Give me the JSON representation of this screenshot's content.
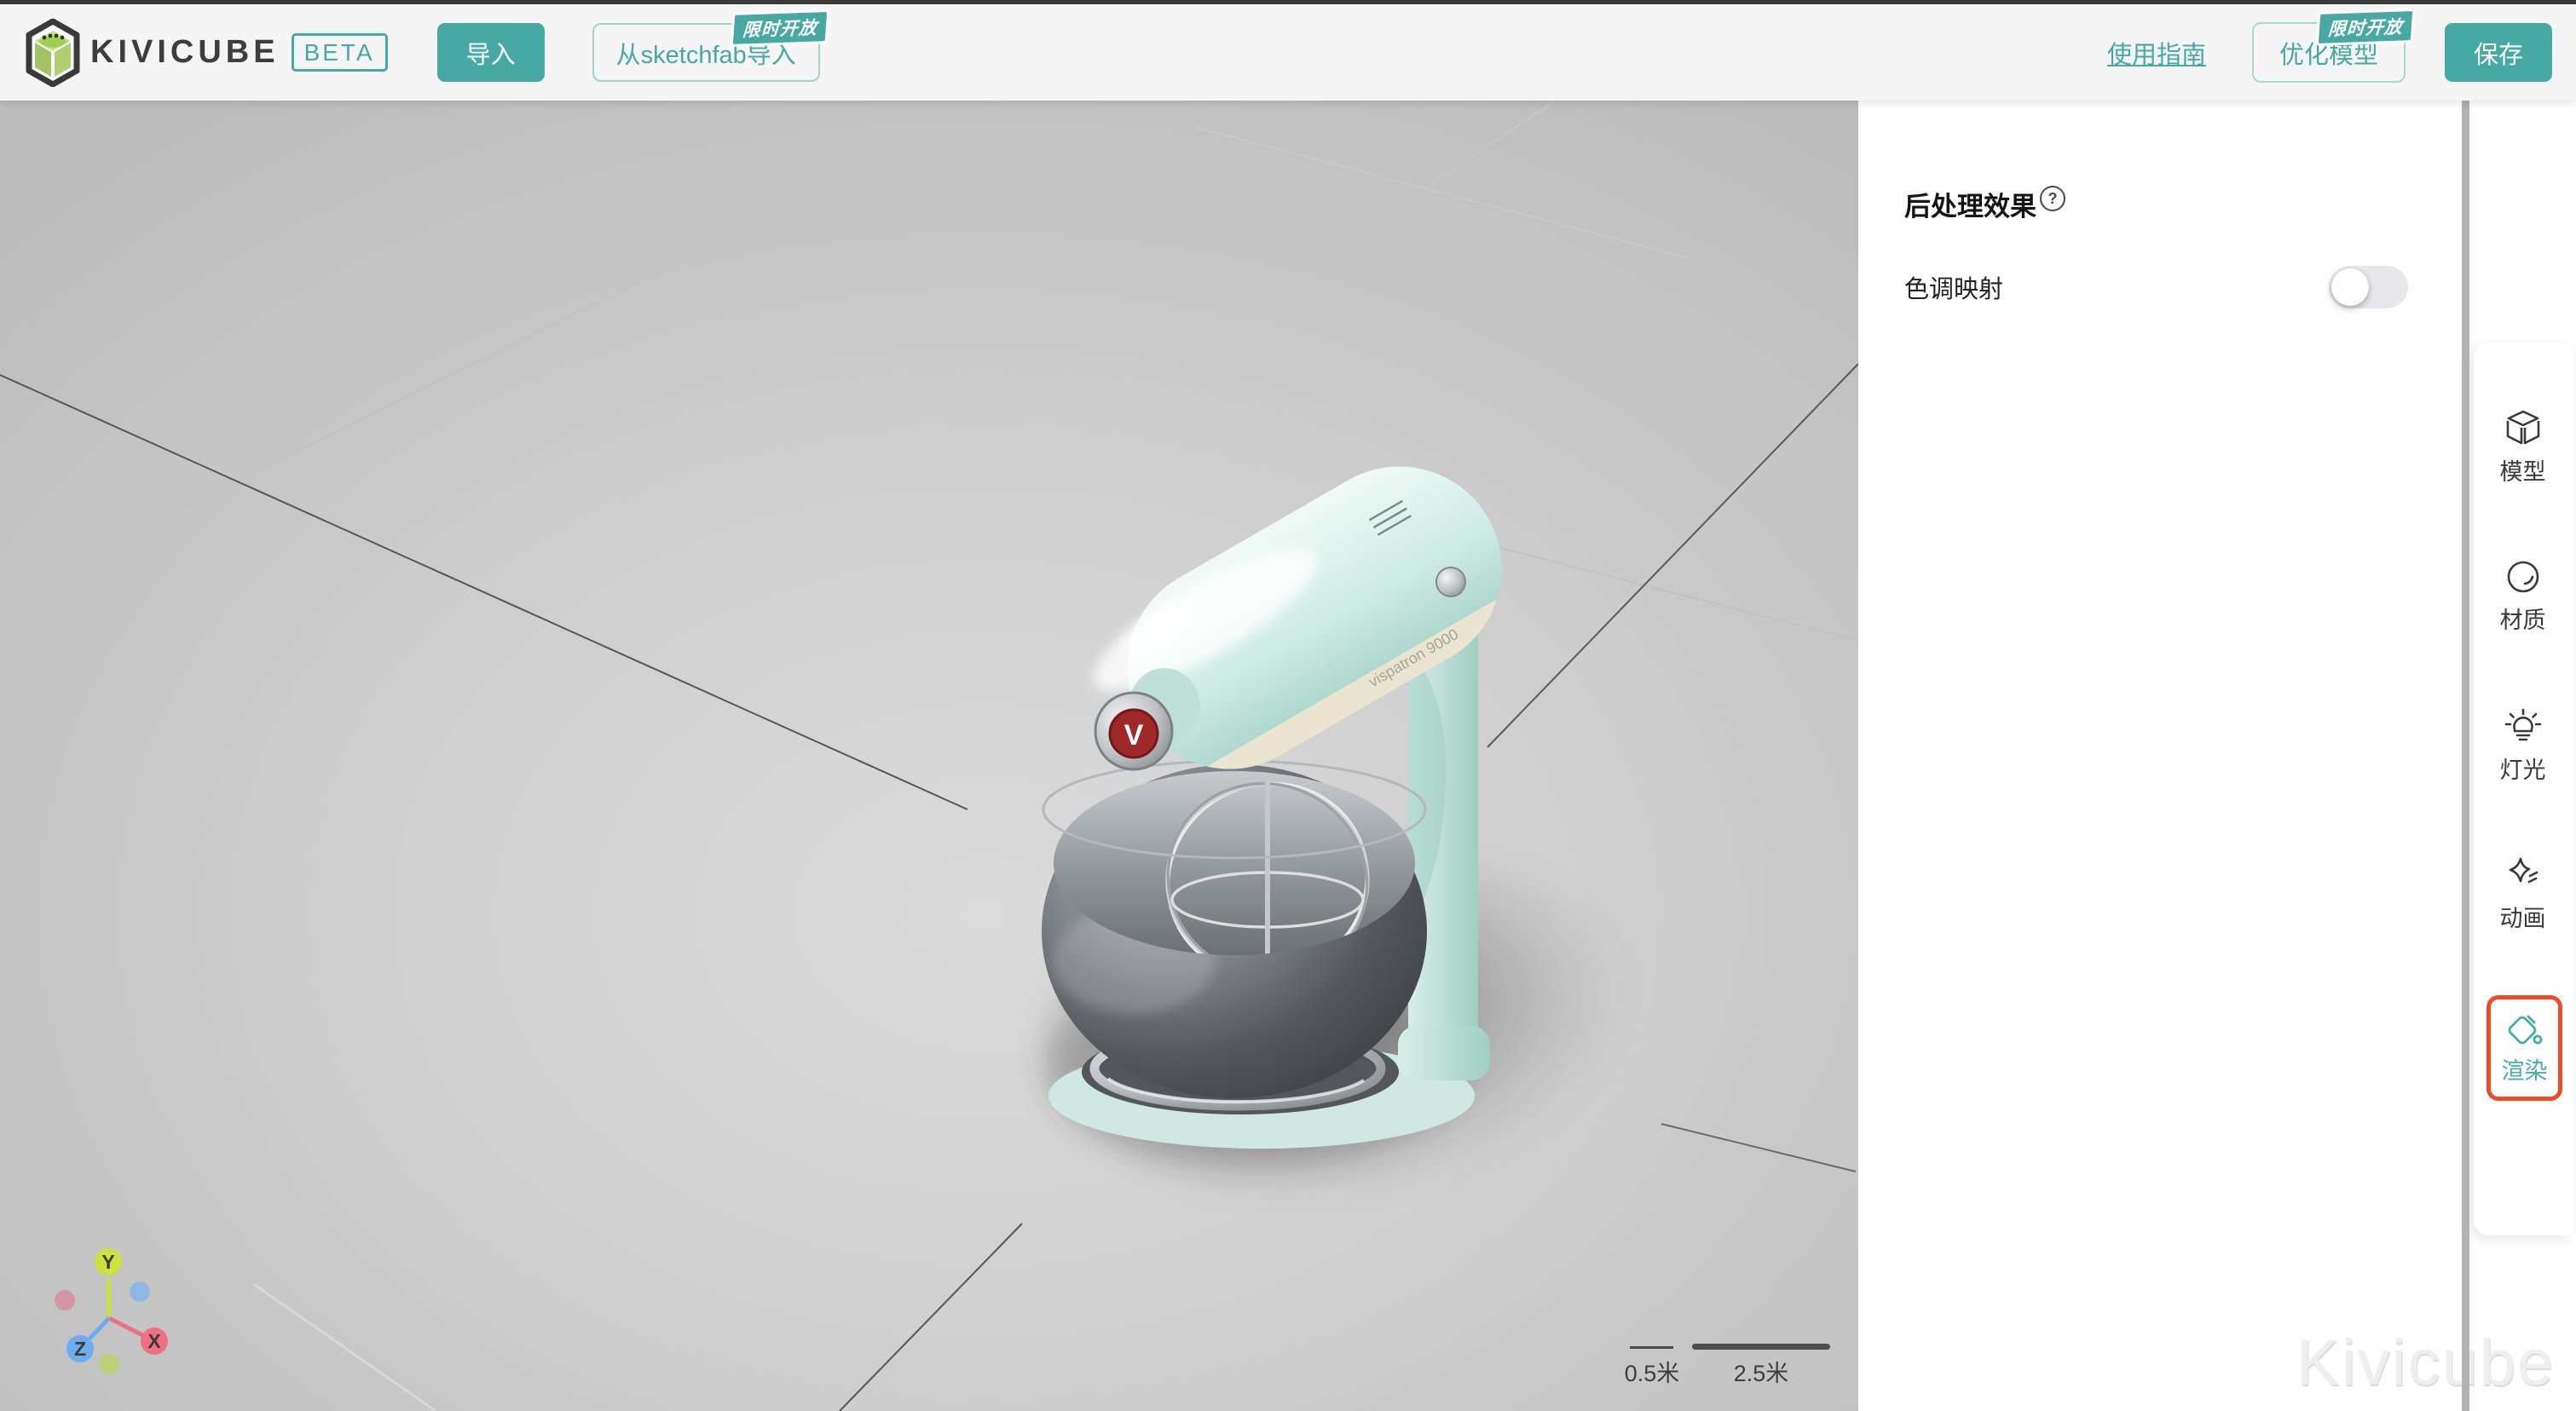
{
  "header": {
    "brand": {
      "name": "KIVICUBE",
      "beta": "BETA"
    },
    "import_label": "导入",
    "sketchfab_label": "从sketchfab导入",
    "limited_badge": "限时开放",
    "guide_label": "使用指南",
    "optimize_label": "优化模型",
    "save_label": "保存"
  },
  "panel": {
    "title": "后处理效果",
    "help_glyph": "?",
    "tone_mapping_label": "色调映射",
    "tone_mapping_enabled": false
  },
  "sidebar": {
    "items": [
      {
        "id": "model",
        "label": "模型",
        "active": false
      },
      {
        "id": "material",
        "label": "材质",
        "active": false
      },
      {
        "id": "light",
        "label": "灯光",
        "active": false
      },
      {
        "id": "animation",
        "label": "动画",
        "active": false
      },
      {
        "id": "render",
        "label": "渲染",
        "active": true
      }
    ]
  },
  "viewport": {
    "scale_small": "0.5米",
    "scale_large": "2.5米",
    "axis": {
      "x": "X",
      "y": "Y",
      "z": "Z"
    },
    "watermark": "Kivicube",
    "model_text": "vispatron 9000",
    "model_badge": "V"
  },
  "colors": {
    "accent": "#46a9a3",
    "accent_border": "#9ed3d0",
    "highlight_red": "#f04b28",
    "axis_x": "#ee7082",
    "axis_y": "#cde23e",
    "axis_z": "#6fabef",
    "mixer_mint": "#cdeae2",
    "toggle_off_track": "#e8e8ec",
    "scrollbar": "#b2b2b2",
    "header_bg": "#f5f5f5"
  }
}
